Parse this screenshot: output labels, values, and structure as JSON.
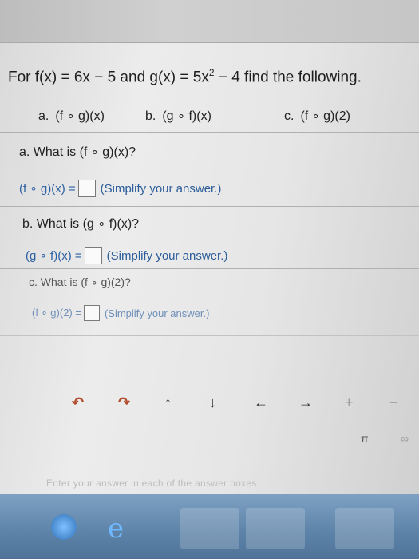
{
  "question": {
    "prefix": "For f(x) = 6x − 5 and g(x) = 5x",
    "exponent": "2",
    "suffix": " − 4 find the following."
  },
  "parts": [
    {
      "label": "a.",
      "expr": "(f ∘ g)(x)"
    },
    {
      "label": "b.",
      "expr": "(g ∘ f)(x)"
    },
    {
      "label": "c.",
      "expr": "(f ∘ g)(2)"
    }
  ],
  "items": [
    {
      "question": "a. What is (f ∘ g)(x)?",
      "answer_prefix": "(f ∘ g)(x) =",
      "hint": "(Simplify your answer.)"
    },
    {
      "question": "b. What is (g ∘ f)(x)?",
      "answer_prefix": "(g ∘ f)(x) =",
      "hint": "(Simplify your answer.)"
    },
    {
      "question": "c. What is (f ∘ g)(2)?",
      "answer_prefix": "(f ∘ g)(2) =",
      "hint": "(Simplify your answer.)"
    }
  ],
  "toolbar": {
    "undo": "↶",
    "redo": "↷",
    "up": "↑",
    "down": "↓",
    "left": "←",
    "right": "→",
    "plus": "+",
    "minus": "−",
    "pi": "π",
    "infinity": "∞"
  },
  "footer": {
    "hint": "Enter your answer in each of the answer boxes."
  },
  "taskbar": {
    "ie_glyph": "e"
  }
}
